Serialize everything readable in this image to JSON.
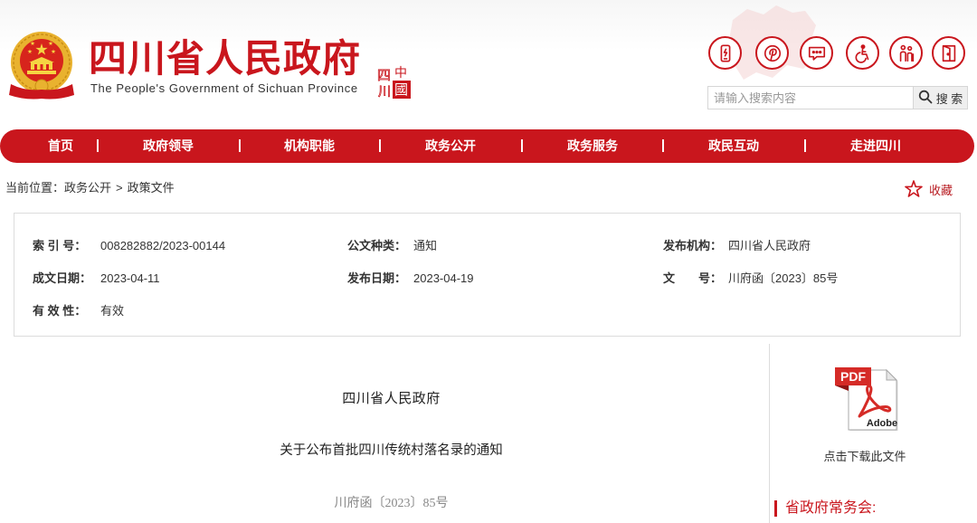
{
  "header": {
    "title": "四川省人民政府",
    "subtitle": "The People's Government of Sichuan Province",
    "emblem_icon": "national-emblem-icon",
    "seal": {
      "chars": [
        "中",
        "國",
        "四",
        "川"
      ]
    },
    "tool_icons": [
      "mobile-phone-icon",
      "p-logo-icon",
      "message-icon",
      "accessibility-icon",
      "elderly-care-icon",
      "exit-door-icon"
    ],
    "search": {
      "placeholder": "请输入搜索内容",
      "button_label": "搜 索",
      "button_icon": "search-icon"
    }
  },
  "nav": {
    "items": [
      "首页",
      "政府领导",
      "机构职能",
      "政务公开",
      "政务服务",
      "政民互动",
      "走进四川"
    ],
    "separator": "|"
  },
  "breadcrumb": {
    "prefix": "当前位置：",
    "items": [
      "政务公开",
      "政策文件"
    ],
    "separator": ">"
  },
  "favorite": {
    "icon": "star-outline-icon",
    "label": "收藏"
  },
  "meta": {
    "index_no": {
      "label": "索 引 号：",
      "value": "008282882/2023-00144"
    },
    "doc_type": {
      "label": "公文种类：",
      "value": "通知"
    },
    "publisher": {
      "label": "发布机构：",
      "value": "四川省人民政府"
    },
    "written_date": {
      "label": "成文日期：",
      "value": "2023-04-11"
    },
    "publish_date": {
      "label": "发布日期：",
      "value": "2023-04-19"
    },
    "doc_no": {
      "label": "文　　号：",
      "value": "川府函〔2023〕85号"
    },
    "validity": {
      "label": "有 效 性：",
      "value": "有效"
    }
  },
  "document": {
    "issuer": "四川省人民政府",
    "title": "关于公布首批四川传统村落名录的通知",
    "doc_number": "川府函〔2023〕85号"
  },
  "sidebar": {
    "pdf_icon": {
      "name": "pdf-download-icon",
      "badge": "PDF",
      "brand": "Adobe"
    },
    "download_label": "点击下载此文件",
    "section_title": "省政府常务会:"
  },
  "colors": {
    "brand_red": "#c9161d",
    "emblem_gold": "#e9b22f",
    "text": "#333333",
    "muted": "#888888",
    "border": "#dcdcdc"
  }
}
